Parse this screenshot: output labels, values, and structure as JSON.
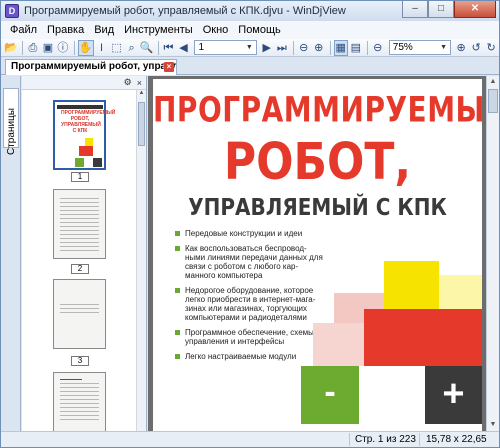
{
  "window": {
    "title": "Программируемый робот, управляемый с КПК.djvu - WinDjView",
    "app_icon_letter": "D",
    "controls": {
      "minimize": "–",
      "maximize": "□",
      "close": "✕"
    }
  },
  "menu": [
    "Файл",
    "Правка",
    "Вид",
    "Инструменты",
    "Окно",
    "Помощь"
  ],
  "toolbar": {
    "icons": [
      "open-icon",
      "print-icon",
      "save-icon",
      "info-icon",
      "hand-tool-icon",
      "text-select-icon",
      "rect-select-icon",
      "zoom-rect-icon",
      "search-icon",
      "first-page-icon",
      "prev-page-icon",
      "next-page-icon",
      "last-page-icon",
      "back-icon",
      "forward-icon",
      "fit-page-icon",
      "continuous-icon",
      "zoom-out-icon",
      "zoom-in-icon",
      "rotate-left-icon",
      "rotate-right-icon"
    ],
    "page_value": "1",
    "zoom_value": "75%"
  },
  "tab": {
    "label": "Программируемый робот, управляе..."
  },
  "sidebar": {
    "tab_label": "Страницы",
    "settings_icon": "⚙",
    "close_icon": "×"
  },
  "thumbnails": [
    {
      "number": "1"
    },
    {
      "number": "2"
    },
    {
      "number": "3"
    }
  ],
  "thumb1": {
    "title": "ПРОГРАММИРУЕМЫЙ РОБОТ, УПРАВЛЯЕМЫЙ С КПК"
  },
  "page": {
    "title_line1": "ПРОГРАММИРУЕМЫЙ",
    "title_line2": "РОБОТ,",
    "title_line3": "УПРАВЛЯЕМЫЙ С КПК",
    "bullets": [
      "Передовые конструкции и идеи",
      "Как воспользоваться беспровод-ными линиями передачи данных для связи с роботом с любого кар-манного компьютера",
      "Недорогое оборудование, которое легко приобрести в интернет-мага-зинах или магазинах, торгующих компьютерами и радиодеталями",
      "Программное обеспечение, схемы управления и интерфейсы",
      "Легко настраиваемые модули"
    ],
    "minus_symbol": "-",
    "plus_symbol": "+",
    "colors": {
      "red": "#e53a2b",
      "yellow": "#f7e300",
      "green": "#6cab30",
      "dark": "#3a3a3a"
    }
  },
  "status": {
    "page_info": "Стр. 1 из 223",
    "size_info": "15,78 x 22,65 см"
  }
}
